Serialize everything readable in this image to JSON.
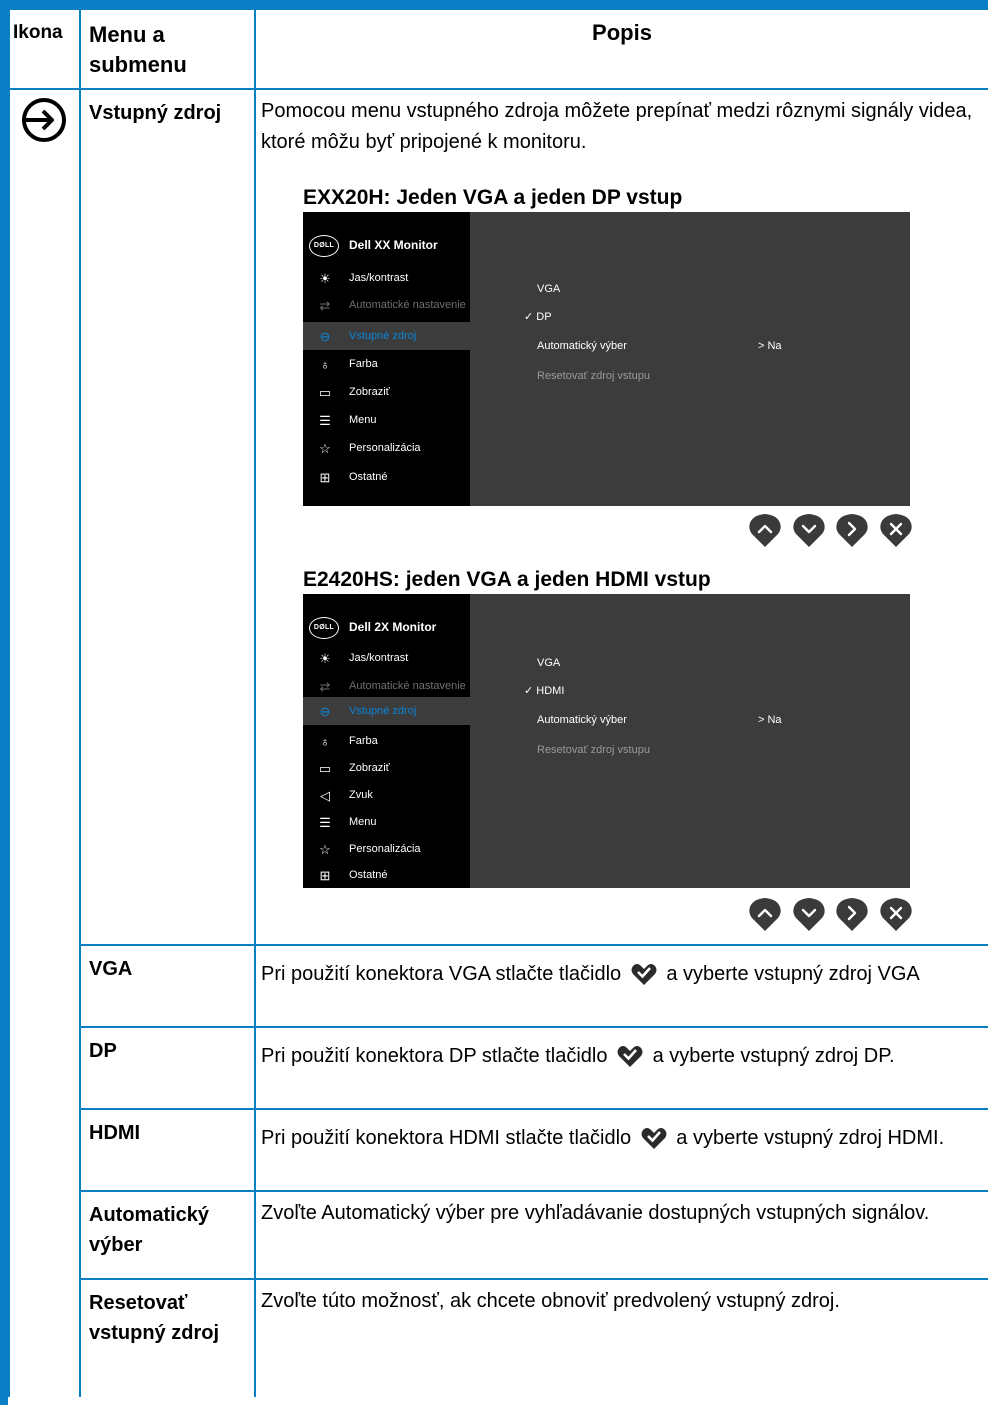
{
  "header": {
    "ikona": "Ikona",
    "menu": "Menu a submenu",
    "popis": "Popis"
  },
  "input_source": {
    "icon": "input-source-icon",
    "label": "Vstupný zdroj",
    "description": "Pomocou menu vstupného zdroja môžete prepínať medzi rôznymi signály videa, ktoré môžu byť pripojené k monitoru.",
    "screens": [
      {
        "title": "EXX20H: Jeden VGA a jeden DP vstup",
        "monitor_name": "Dell XX Monitor",
        "logo_text": "DØLL",
        "menu_items": [
          {
            "label": "Jas/kontrast",
            "icon": "brightness-icon"
          },
          {
            "label": "Automatické nastavenie",
            "icon": "auto-adjust-icon"
          },
          {
            "label": "Vstupné zdroj",
            "icon": "input-source-icon"
          },
          {
            "label": "Farba",
            "icon": "color-icon"
          },
          {
            "label": "Zobraziť",
            "icon": "display-icon"
          },
          {
            "label": "Menu",
            "icon": "menu-icon"
          },
          {
            "label": "Personalizácia",
            "icon": "star-icon"
          },
          {
            "label": "Ostatné",
            "icon": "others-icon"
          }
        ],
        "options": [
          "VGA",
          "DP",
          "Automatický výber",
          "Resetovať zdroj vstupu"
        ],
        "selected_option": "DP",
        "auto_value": "> Na"
      },
      {
        "title": "E2420HS: jeden VGA a jeden HDMI vstup",
        "monitor_name": "Dell 2X Monitor",
        "logo_text": "DØLL",
        "menu_items": [
          {
            "label": "Jas/kontrast",
            "icon": "brightness-icon"
          },
          {
            "label": "Automatické nastavenie",
            "icon": "auto-adjust-icon"
          },
          {
            "label": "Vstupné zdroj",
            "icon": "input-source-icon"
          },
          {
            "label": "Farba",
            "icon": "color-icon"
          },
          {
            "label": "Zobraziť",
            "icon": "display-icon"
          },
          {
            "label": "Zvuk",
            "icon": "speaker-icon"
          },
          {
            "label": "Menu",
            "icon": "menu-icon"
          },
          {
            "label": "Personalizácia",
            "icon": "star-icon"
          },
          {
            "label": "Ostatné",
            "icon": "others-icon"
          }
        ],
        "options": [
          "VGA",
          "HDMI",
          "Automatický výber",
          "Resetovať zdroj vstupu"
        ],
        "selected_option": "HDMI",
        "auto_value": "> Na"
      }
    ],
    "nav_buttons": [
      "up-button",
      "down-button",
      "right-button",
      "close-button"
    ]
  },
  "rows": [
    {
      "name": "VGA",
      "before": "Pri použití konektora VGA stlačte tlačidlo",
      "after": "a vyberte vstupný zdroj VGA"
    },
    {
      "name": "DP",
      "before": "Pri použití konektora DP stlačte tlačidlo",
      "after": "a vyberte vstupný zdroj DP."
    },
    {
      "name": "HDMI",
      "before": "Pri použití konektora HDMI stlačte tlačidlo",
      "after": "a vyberte vstupný zdroj HDMI."
    },
    {
      "name": "Automatický výber",
      "text": "Zvoľte Automatický výber pre vyhľadávanie dostupných vstupných signálov."
    },
    {
      "name": "Resetovať vstupný zdroj",
      "text": "Zvoľte túto možnosť, ak chcete obnoviť predvolený vstupný zdroj."
    }
  ],
  "colors": {
    "accent": "#0b7fc6",
    "osd_active": "#0a84d8",
    "button": "#3a3a3a"
  }
}
